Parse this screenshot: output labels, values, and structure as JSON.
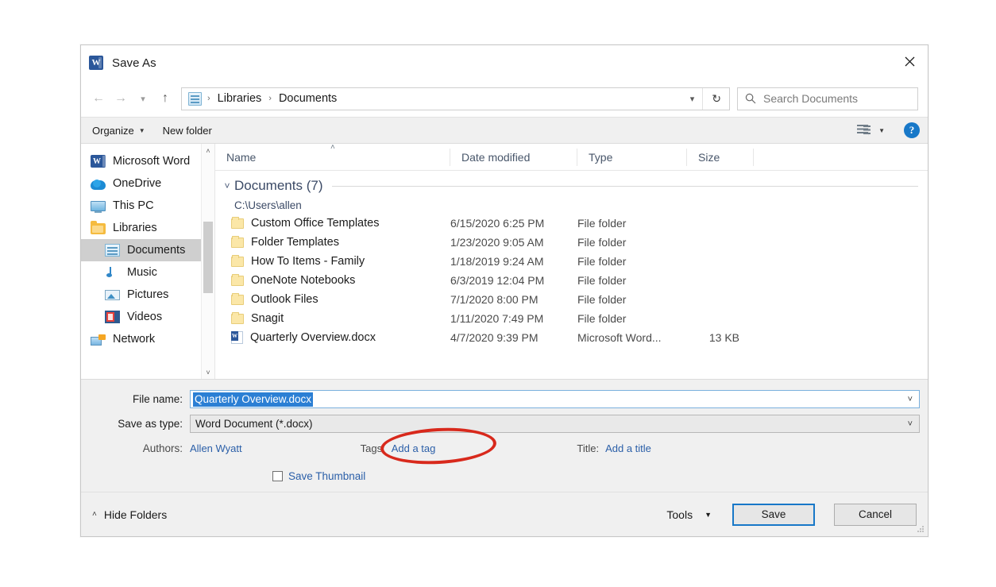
{
  "window": {
    "title": "Save As",
    "app_icon": "word-icon",
    "close_icon": "close-icon"
  },
  "addressbar": {
    "back_icon": "back-arrow-icon",
    "forward_icon": "forward-arrow-icon",
    "recent_icon": "chevron-down-icon",
    "up_icon": "up-arrow-icon",
    "location_icon": "libraries-icon",
    "crumbs": [
      "Libraries",
      "Documents"
    ],
    "separator": "›",
    "dropdown_icon": "chevron-down-icon",
    "refresh_icon": "refresh-icon",
    "refresh_glyph": "↻"
  },
  "search": {
    "icon": "search-icon",
    "placeholder": "Search Documents",
    "value": ""
  },
  "commandbar": {
    "organize_label": "Organize",
    "organize_caret": "▼",
    "new_folder_label": "New folder",
    "view_icon": "view-options-icon",
    "view_caret": "▼",
    "help_icon": "help-icon",
    "help_glyph": "?"
  },
  "sidebar": {
    "items": [
      {
        "label": "Microsoft Word",
        "icon": "word-icon",
        "indent": false,
        "selected": false
      },
      {
        "label": "OneDrive",
        "icon": "onedrive-cloud-icon",
        "indent": false,
        "selected": false
      },
      {
        "label": "This PC",
        "icon": "this-pc-icon",
        "indent": false,
        "selected": false
      },
      {
        "label": "Libraries",
        "icon": "libraries-icon",
        "indent": false,
        "selected": false
      },
      {
        "label": "Documents",
        "icon": "documents-library-icon",
        "indent": true,
        "selected": true
      },
      {
        "label": "Music",
        "icon": "music-library-icon",
        "indent": true,
        "selected": false
      },
      {
        "label": "Pictures",
        "icon": "pictures-library-icon",
        "indent": true,
        "selected": false
      },
      {
        "label": "Videos",
        "icon": "videos-library-icon",
        "indent": true,
        "selected": false
      },
      {
        "label": "Network",
        "icon": "network-icon",
        "indent": false,
        "selected": false
      }
    ],
    "scroll_up_glyph": "˄",
    "scroll_down_glyph": "˅"
  },
  "filelist": {
    "columns": [
      "Name",
      "Date modified",
      "Type",
      "Size"
    ],
    "sort_indicator": "˄",
    "group": {
      "chevron": "˅",
      "title": "Documents (7)",
      "path": "C:\\Users\\allen"
    },
    "rows": [
      {
        "name": "Custom Office Templates",
        "date": "6/15/2020 6:25 PM",
        "type": "File folder",
        "size": "",
        "icon": "folder-icon"
      },
      {
        "name": "Folder Templates",
        "date": "1/23/2020 9:05 AM",
        "type": "File folder",
        "size": "",
        "icon": "folder-icon"
      },
      {
        "name": "How To Items - Family",
        "date": "1/18/2019 9:24 AM",
        "type": "File folder",
        "size": "",
        "icon": "folder-icon"
      },
      {
        "name": "OneNote Notebooks",
        "date": "6/3/2019 12:04 PM",
        "type": "File folder",
        "size": "",
        "icon": "folder-icon"
      },
      {
        "name": "Outlook Files",
        "date": "7/1/2020 8:00 PM",
        "type": "File folder",
        "size": "",
        "icon": "folder-icon"
      },
      {
        "name": "Snagit",
        "date": "1/11/2020 7:49 PM",
        "type": "File folder",
        "size": "",
        "icon": "folder-icon"
      },
      {
        "name": "Quarterly Overview.docx",
        "date": "4/7/2020 9:39 PM",
        "type": "Microsoft Word...",
        "size": "13 KB",
        "icon": "word-document-icon"
      }
    ]
  },
  "form": {
    "filename_label": "File name:",
    "filename_value": "Quarterly Overview.docx",
    "filename_caret": "˅",
    "savetype_label": "Save as type:",
    "savetype_value": "Word Document (*.docx)",
    "savetype_caret": "˅",
    "authors_label": "Authors:",
    "authors_value": "Allen Wyatt",
    "tags_label": "Tags:",
    "tags_value": "Add a tag",
    "title_label": "Title:",
    "title_value": "Add a title",
    "thumbnail_label": "Save Thumbnail",
    "thumbnail_checked": false
  },
  "footer": {
    "hide_folders_label": "Hide Folders",
    "hide_folders_caret": "˄",
    "tools_label": "Tools",
    "tools_caret": "▼",
    "save_label": "Save",
    "cancel_label": "Cancel",
    "resize_grip": "resize-grip-icon"
  },
  "annotation": {
    "shape": "ellipse",
    "color": "#d8291c",
    "targets": "Tags: Add a tag"
  },
  "colors": {
    "accent": "#1878c8",
    "word_blue": "#2b579a",
    "selection_blue": "#2b7fd4",
    "annotation_red": "#d8291c",
    "link_blue": "#2b5fa8",
    "panel_gray": "#f0f0f0"
  }
}
